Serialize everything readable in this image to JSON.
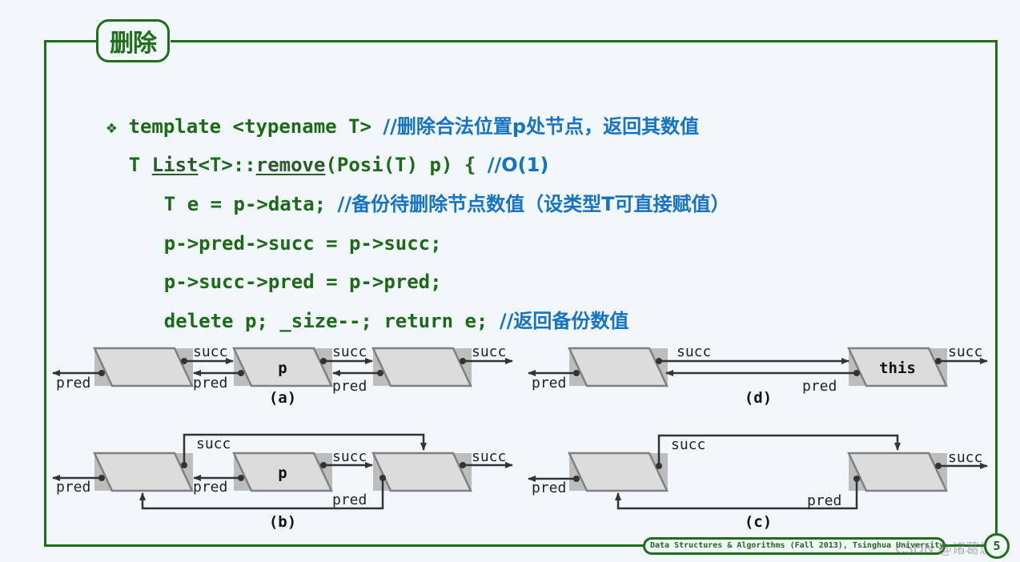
{
  "slide": {
    "title": "删除",
    "page_number": "5",
    "footer": "Data Structures & Algorithms (Fall 2013), Tsinghua University",
    "watermark": "CSDN @诸葛悠闲"
  },
  "colors": {
    "frame": "#1f6f1a",
    "code": "#1c6a18",
    "comment": "#1573c2",
    "node_fill": "#dcdcdc",
    "node_shadow": "#bdbdbd",
    "arrow": "#333333"
  },
  "code": {
    "bullet": "❖",
    "lines": [
      {
        "code": "template <typename T> ",
        "comment": "//删除合法位置p处节点，返回其数值"
      },
      {
        "pre": "T ",
        "link1": "List",
        "mid": "<T>::",
        "link2": "remove",
        "post": "(Posi(T) p) { ",
        "comment": "//O(1)"
      },
      {
        "code": "T e = p->data; ",
        "comment": "//备份待删除节点数值（设类型T可直接赋值）"
      },
      {
        "code": "p->pred->succ = p->succ;",
        "comment": ""
      },
      {
        "code": "p->succ->pred = p->pred;",
        "comment": ""
      },
      {
        "code": "delete p; _size--; return e; ",
        "comment": "//返回备份数值"
      },
      {
        "code": "}",
        "comment": ""
      }
    ]
  },
  "diagrams": {
    "a": {
      "caption": "(a)",
      "node_label": "p",
      "succ": "succ",
      "pred": "pred"
    },
    "b": {
      "caption": "(b)",
      "node_label": "p",
      "succ": "succ",
      "pred": "pred"
    },
    "c": {
      "caption": "(c)",
      "succ": "succ",
      "pred": "pred"
    },
    "d": {
      "caption": "(d)",
      "node_label": "this",
      "succ": "succ",
      "pred": "pred"
    }
  }
}
